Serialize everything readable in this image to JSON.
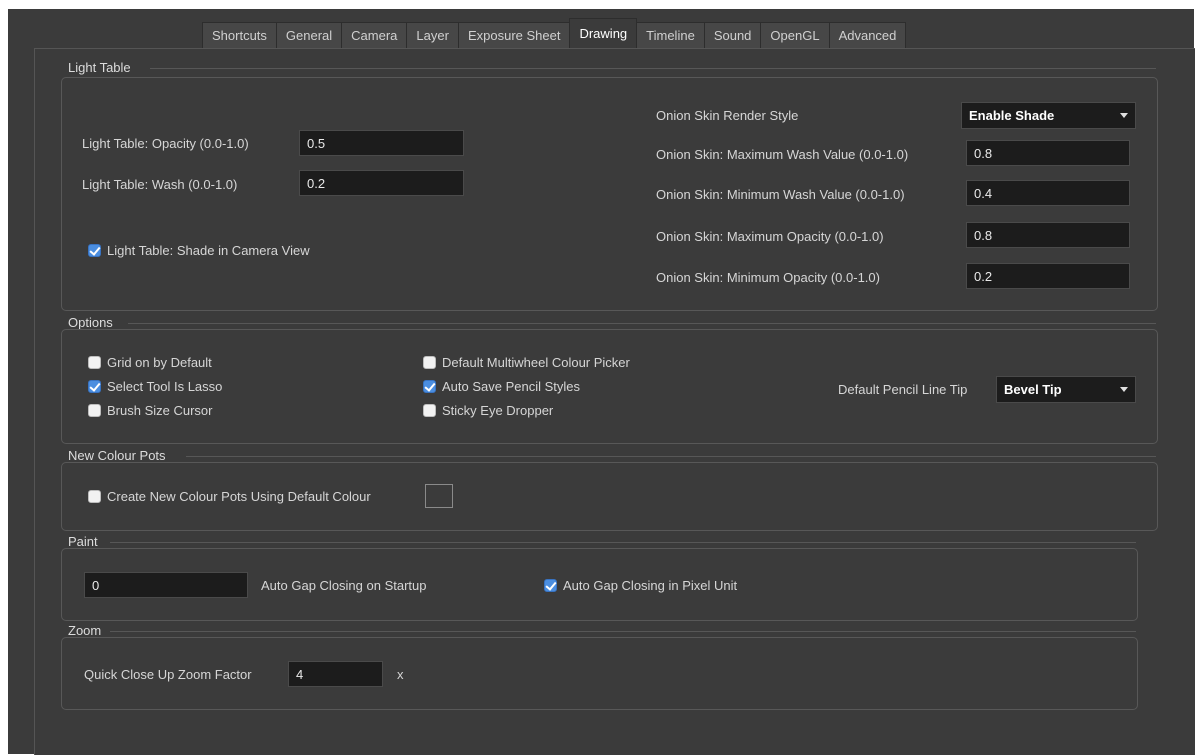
{
  "tabs": [
    "Shortcuts",
    "General",
    "Camera",
    "Layer",
    "Exposure Sheet",
    "Drawing",
    "Timeline",
    "Sound",
    "OpenGL",
    "Advanced"
  ],
  "active_tab": "Drawing",
  "light_table": {
    "title": "Light Table",
    "opacity_label": "Light Table: Opacity (0.0-1.0)",
    "opacity_value": "0.5",
    "wash_label": "Light Table: Wash (0.0-1.0)",
    "wash_value": "0.2",
    "shade_label": "Light Table: Shade in Camera View",
    "onion_style_label": "Onion Skin Render Style",
    "onion_style_value": "Enable Shade",
    "max_wash_label": "Onion Skin: Maximum Wash Value (0.0-1.0)",
    "max_wash_value": "0.8",
    "min_wash_label": "Onion Skin: Minimum Wash Value (0.0-1.0)",
    "min_wash_value": "0.4",
    "max_opacity_label": "Onion Skin: Maximum Opacity (0.0-1.0)",
    "max_opacity_value": "0.8",
    "min_opacity_label": "Onion Skin: Minimum Opacity (0.0-1.0)",
    "min_opacity_value": "0.2"
  },
  "options": {
    "title": "Options",
    "grid_label": "Grid on by Default",
    "lasso_label": "Select Tool Is Lasso",
    "brush_label": "Brush Size Cursor",
    "multiwheel_label": "Default Multiwheel Colour Picker",
    "autosave_label": "Auto Save Pencil Styles",
    "sticky_label": "Sticky Eye Dropper",
    "pencil_tip_label": "Default Pencil Line Tip",
    "pencil_tip_value": "Bevel Tip"
  },
  "colour_pots": {
    "title": "New Colour Pots",
    "create_label": "Create New Colour Pots Using Default Colour"
  },
  "paint": {
    "title": "Paint",
    "gap_value": "0",
    "gap_label": "Auto Gap Closing on Startup",
    "pixel_label": "Auto Gap Closing in Pixel Unit"
  },
  "zoom": {
    "title": "Zoom",
    "factor_label": "Quick Close Up Zoom Factor",
    "factor_value": "4",
    "unit": "x"
  }
}
